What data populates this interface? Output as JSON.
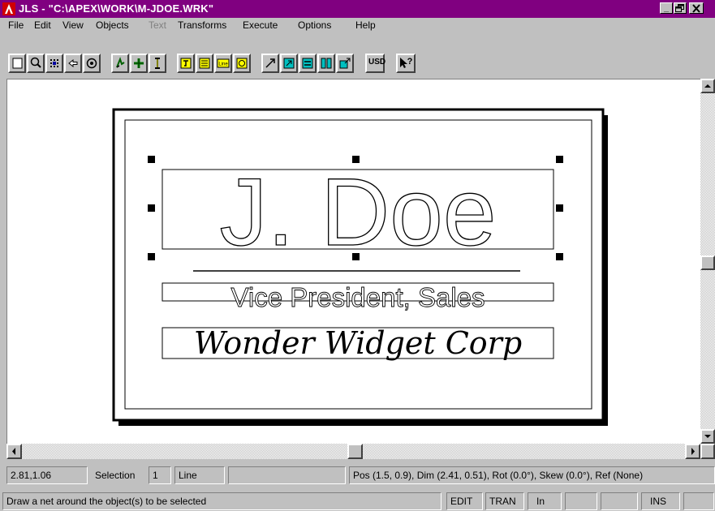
{
  "window": {
    "title": "JLS - \"C:\\APEX\\WORK\\M-JDOE.WRK\"",
    "title_bar_color": "#800080",
    "icon": "apex-logo-icon",
    "controls": {
      "minimize": "_",
      "restore": "🗗",
      "close": "✕"
    }
  },
  "menu": {
    "items": [
      {
        "label": "File",
        "enabled": true
      },
      {
        "label": "Edit",
        "enabled": true
      },
      {
        "label": "View",
        "enabled": true
      },
      {
        "label": "Objects",
        "enabled": true
      },
      {
        "label": "Text",
        "enabled": false
      },
      {
        "label": "Transforms",
        "enabled": true
      },
      {
        "label": "Execute",
        "enabled": true
      },
      {
        "label": "Options",
        "enabled": true
      },
      {
        "label": "Help",
        "enabled": true
      }
    ]
  },
  "toolbar": {
    "usd_label": "USD",
    "icons": [
      "new-icon",
      "zoom-icon",
      "grid-icon",
      "back-icon",
      "target-icon",
      "select-arrow-icon",
      "cross-add-icon",
      "text-cursor-icon",
      "object-icon-1",
      "object-icon-2",
      "object-icon-3",
      "object-icon-4",
      "transform-icon-1",
      "transform-icon-2",
      "transform-icon-3",
      "transform-icon-4",
      "transform-icon-5",
      "usd-icon",
      "help-pointer-icon"
    ]
  },
  "card": {
    "name": "J. Doe",
    "title": "Vice President, Sales",
    "company": "Wonder Widget Corp"
  },
  "status": {
    "coords": "2.81,1.06",
    "selection_label": "Selection",
    "selection_count": "1",
    "selection_type": "Line",
    "info": "Pos (1.5, 0.9), Dim (2.41, 0.51), Rot (0.0°), Skew (0.0°), Ref (None)",
    "hint": "Draw a net around the object(s) to be selected",
    "mode_edit": "EDIT",
    "mode_tran": "TRAN",
    "unit": "In",
    "ins": "INS"
  }
}
